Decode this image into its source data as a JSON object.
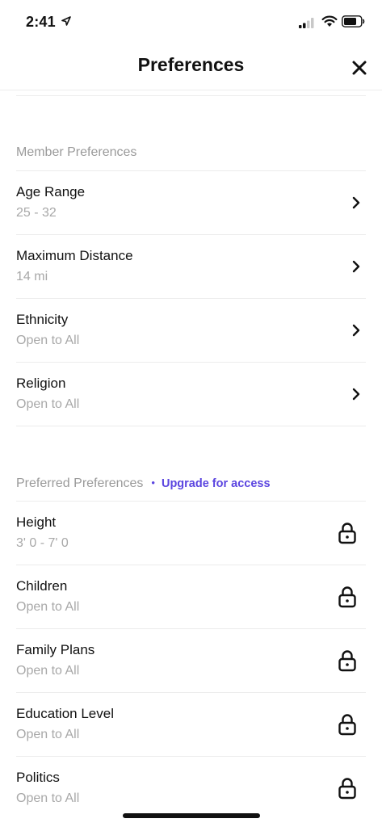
{
  "status_bar": {
    "time": "2:41",
    "icons": [
      "location-arrow-icon",
      "cellular-signal-icon",
      "wifi-icon",
      "battery-icon"
    ]
  },
  "header": {
    "title": "Preferences",
    "close_icon": "close-icon"
  },
  "member_section": {
    "title": "Member Preferences",
    "items": [
      {
        "label": "Age Range",
        "value": "25 - 32"
      },
      {
        "label": "Maximum Distance",
        "value": "14 mi"
      },
      {
        "label": "Ethnicity",
        "value": "Open to All"
      },
      {
        "label": "Religion",
        "value": "Open to All"
      }
    ]
  },
  "preferred_section": {
    "title": "Preferred Preferences",
    "separator": "•",
    "upgrade_label": "Upgrade for access",
    "items": [
      {
        "label": "Height",
        "value": "3' 0 - 7' 0"
      },
      {
        "label": "Children",
        "value": "Open to All"
      },
      {
        "label": "Family Plans",
        "value": "Open to All"
      },
      {
        "label": "Education Level",
        "value": "Open to All"
      },
      {
        "label": "Politics",
        "value": "Open to All"
      }
    ]
  },
  "colors": {
    "accent": "#5b45e0",
    "secondary_text": "#a8a8a8",
    "divider": "#ececec"
  }
}
